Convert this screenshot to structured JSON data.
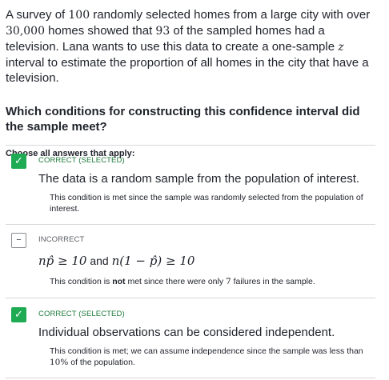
{
  "prompt": {
    "p1": "A survey of ",
    "n_sample": "100",
    "p2": " randomly selected homes from a large city with over ",
    "n_pop": "30,000",
    "p3": " homes showed that ",
    "n_tv": "93",
    "p4": " of the sampled homes had a television. Lana wants to use this data to create a one-sample ",
    "z": "z",
    "p5": " interval to estimate the proportion of all homes in the city that have a television."
  },
  "question": "Which conditions for constructing this confidence interval did the sample meet?",
  "instructions": "Choose all answers that apply:",
  "choices": [
    {
      "status": "CORRECT (SELECTED)",
      "mark": "✓",
      "answer": "The data is a random sample from the population of interest.",
      "explanation": "This condition is met since the sample was randomly selected from the population of interest."
    },
    {
      "status": "INCORRECT",
      "mark": "–",
      "answer_parts": {
        "a1": "np̂ ≥ 10",
        "a2": " and ",
        "a3": "n(1 − p̂) ≥ 10"
      },
      "explanation_parts": {
        "e1": "This condition is ",
        "e2": "not",
        "e3": " met since there were only ",
        "e4": "7",
        "e5": " failures in the sample."
      }
    },
    {
      "status": "CORRECT (SELECTED)",
      "mark": "✓",
      "answer": "Individual observations can be considered independent.",
      "explanation_parts": {
        "e1": "This condition is met; we can assume independence since the sample was less than ",
        "e2": "10%",
        "e3": " of the population."
      }
    }
  ],
  "colors": {
    "correct_green": "#1fab54",
    "rule_gray": "#d6d8da"
  }
}
